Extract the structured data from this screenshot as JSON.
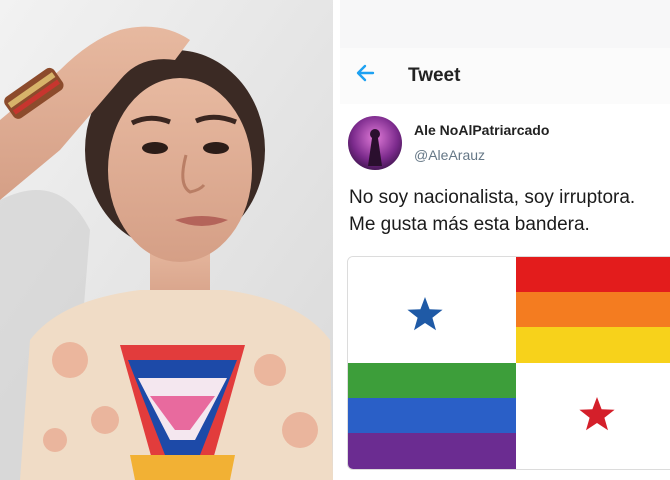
{
  "header": {
    "title": "Tweet"
  },
  "tweet": {
    "display_name": "Ale NoAlPatriarcado",
    "handle": "@AleArauz",
    "text": "No soy nacionalista, soy irruptora.\nMe gusta más esta bandera."
  },
  "icons": {
    "back": "back-arrow-icon",
    "star": "star-icon"
  },
  "colors": {
    "accent": "#1da1f2",
    "flag_star_blue": "#1f5aa6",
    "flag_star_red": "#d41f2a",
    "rainbow": [
      "#e31c1c",
      "#f47c20",
      "#f7d21b",
      "#3d9e3a",
      "#2a5fc7",
      "#6b2c91"
    ]
  }
}
